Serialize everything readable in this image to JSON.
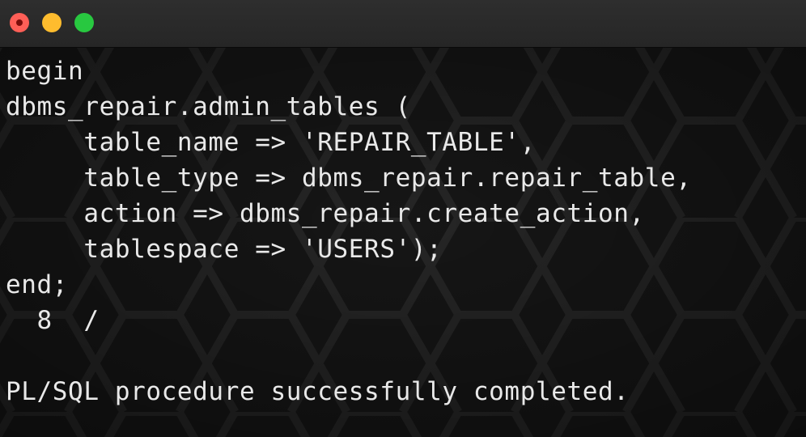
{
  "window": {
    "colors": {
      "close": "#ff5f57",
      "minimize": "#febc2e",
      "maximize": "#28c840",
      "background": "#141414",
      "text": "#e9e9e9"
    }
  },
  "terminal": {
    "lines": [
      "begin",
      "dbms_repair.admin_tables (",
      "     table_name => 'REPAIR_TABLE',",
      "     table_type => dbms_repair.repair_table,",
      "     action => dbms_repair.create_action,",
      "     tablespace => 'USERS');",
      "end;",
      "  8  /",
      "",
      "PL/SQL procedure successfully completed."
    ]
  }
}
